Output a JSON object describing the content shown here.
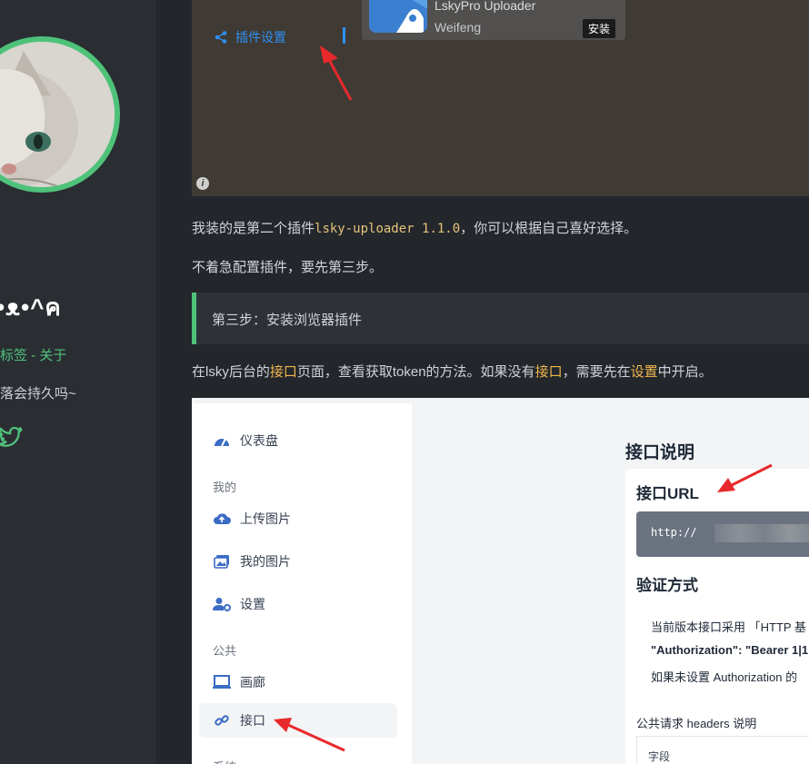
{
  "sidebar": {
    "nickname": "•ᴥ•^ค",
    "links": [
      "标签",
      "关于"
    ],
    "link_separator": "-",
    "motto": "落会持久吗~"
  },
  "plugin_screenshot": {
    "settings_label": "插件设置",
    "card": {
      "title": "LskyPro Uploader",
      "author": "Weifeng",
      "install": "安装"
    },
    "info_icon": "i"
  },
  "article": {
    "p1_before": "我装的是第二个插件",
    "p1_code": "lsky-uploader 1.1.0",
    "p1_after": "，你可以根据自己喜好选择。",
    "p2": "不着急配置插件，要先第三步。",
    "step3": "第三步：安装浏览器插件",
    "p3_a": "在lsky后台的",
    "p3_b": "接口",
    "p3_c": "页面，查看获取token的方法。如果没有",
    "p3_d": "接口",
    "p3_e": "，需要先在",
    "p3_f": "设置",
    "p3_g": "中开启。"
  },
  "lsky_screenshot": {
    "nav": {
      "dashboard": "仪表盘",
      "group_mine": "我的",
      "upload": "上传图片",
      "my_images": "我的图片",
      "settings": "设置",
      "group_public": "公共",
      "gallery": "画廊",
      "api": "接口",
      "group_system": "系统"
    },
    "doc": {
      "title": "接口说明",
      "url_heading": "接口URL",
      "url_text": "http://",
      "auth_heading": "验证方式",
      "line1": "当前版本接口采用 「HTTP 基",
      "line2": "\"Authorization\": \"Bearer 1|1",
      "line3": "如果未设置 Authorization 的",
      "headers_title": "公共请求 headers 说明",
      "table_col1": "字段"
    }
  },
  "colors": {
    "accent_green": "#4fc27a",
    "link_blue": "#2f8ff1",
    "highlight": "#f0b64b",
    "arrow_red": "#e8292b"
  }
}
